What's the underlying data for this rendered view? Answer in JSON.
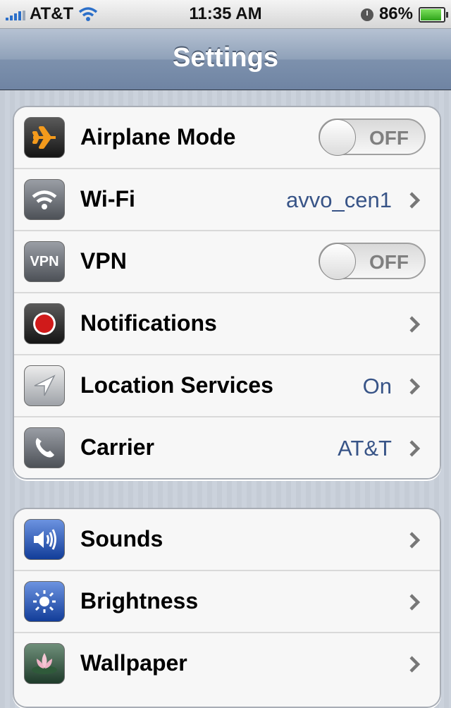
{
  "status_bar": {
    "carrier": "AT&T",
    "time": "11:35 AM",
    "battery_percent": "86%",
    "battery_level": 0.86,
    "icons": [
      "signal-bars-icon",
      "wifi-icon",
      "clock-icon",
      "battery-icon"
    ]
  },
  "nav": {
    "title": "Settings"
  },
  "groups": [
    {
      "rows": [
        {
          "label": "Airplane Mode",
          "icon": "airplane-icon",
          "control": "toggle",
          "toggle_text": "OFF"
        },
        {
          "label": "Wi-Fi",
          "icon": "wifi-icon",
          "value": "avvo_cen1",
          "control": "chevron"
        },
        {
          "label": "VPN",
          "icon": "vpn-icon",
          "icon_text": "VPN",
          "control": "toggle",
          "toggle_text": "OFF"
        },
        {
          "label": "Notifications",
          "icon": "notifications-icon",
          "control": "chevron"
        },
        {
          "label": "Location Services",
          "icon": "location-arrow-icon",
          "value": "On",
          "control": "chevron"
        },
        {
          "label": "Carrier",
          "icon": "phone-icon",
          "value": "AT&T",
          "control": "chevron"
        }
      ]
    },
    {
      "rows": [
        {
          "label": "Sounds",
          "icon": "speaker-icon",
          "control": "chevron"
        },
        {
          "label": "Brightness",
          "icon": "sun-icon",
          "control": "chevron"
        },
        {
          "label": "Wallpaper",
          "icon": "lotus-icon",
          "control": "chevron"
        }
      ]
    }
  ],
  "colors": {
    "value_text": "#385487",
    "nav_bar": "#7d91ad",
    "toggle_off_text": "#7f7f7f"
  }
}
